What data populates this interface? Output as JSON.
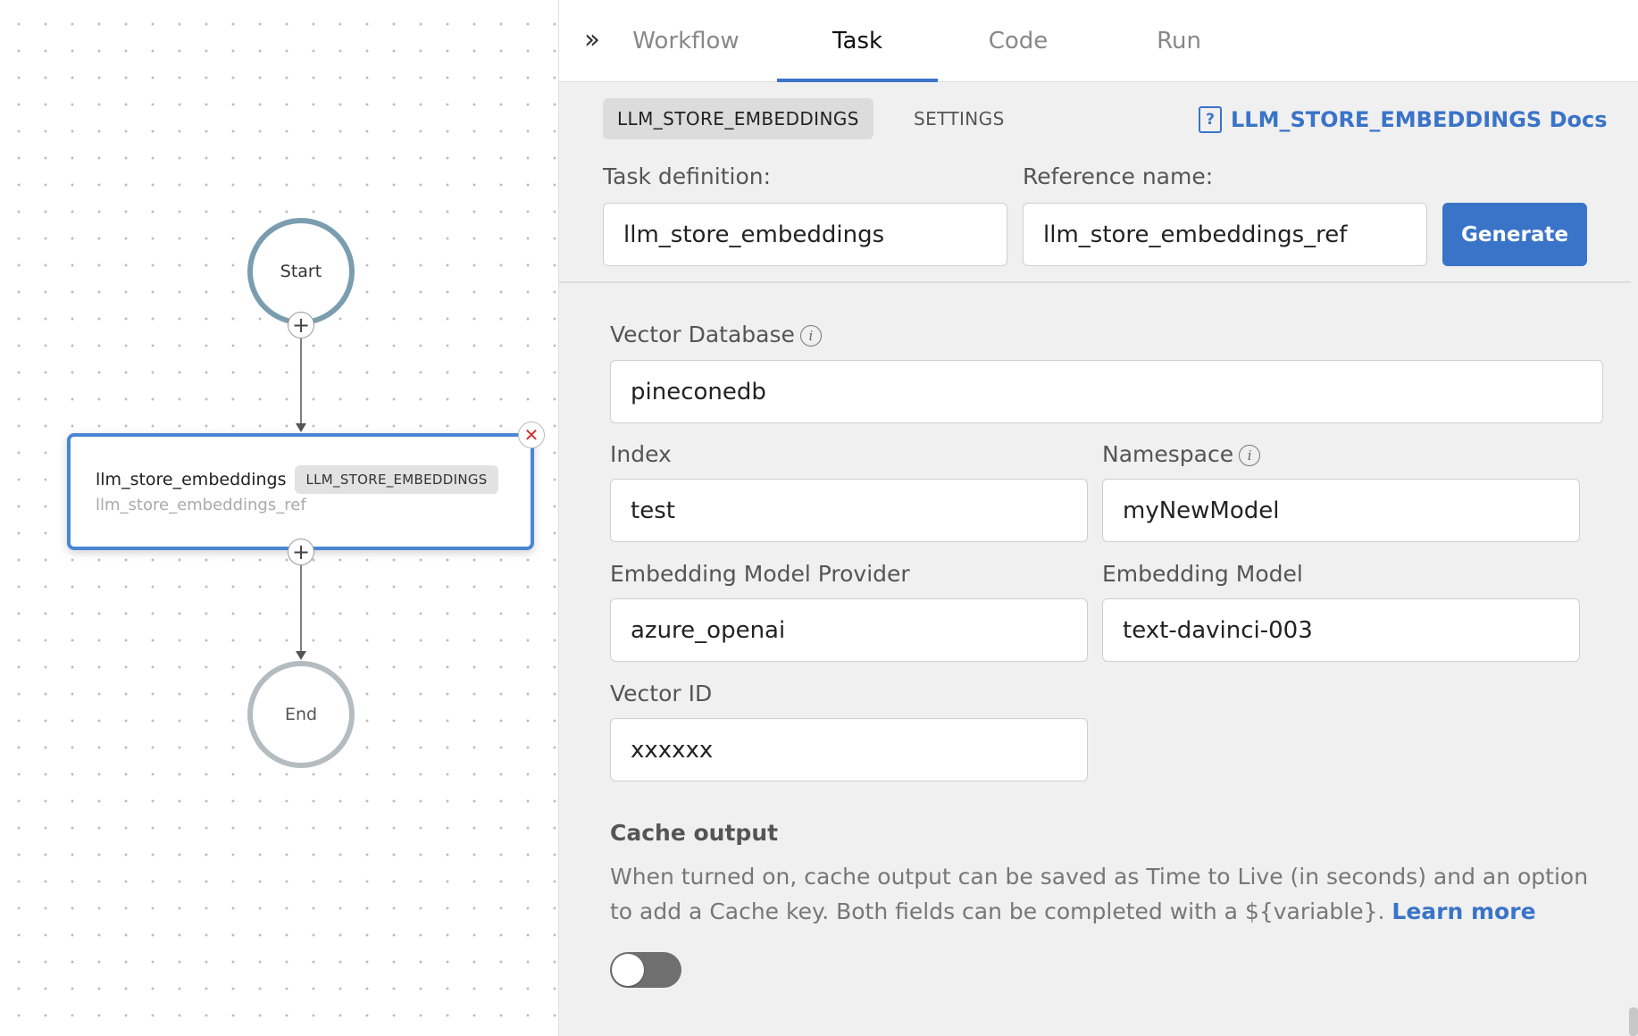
{
  "canvas": {
    "start_label": "Start",
    "end_label": "End",
    "task_node": {
      "name": "llm_store_embeddings",
      "type": "LLM_STORE_EMBEDDINGS",
      "ref": "llm_store_embeddings_ref"
    }
  },
  "tabs": [
    {
      "label": "Workflow",
      "active": false
    },
    {
      "label": "Task",
      "active": true
    },
    {
      "label": "Code",
      "active": false
    },
    {
      "label": "Run",
      "active": false
    }
  ],
  "subnav": {
    "active_chip": "LLM_STORE_EMBEDDINGS",
    "settings_chip": "SETTINGS",
    "docs_link": "LLM_STORE_EMBEDDINGS Docs"
  },
  "task_definition": {
    "label": "Task definition:",
    "value": "llm_store_embeddings"
  },
  "reference_name": {
    "label": "Reference name:",
    "value": "llm_store_embeddings_ref"
  },
  "generate_label": "Generate",
  "form": {
    "vector_database": {
      "label": "Vector Database",
      "value": "pineconedb"
    },
    "index": {
      "label": "Index",
      "value": "test"
    },
    "namespace": {
      "label": "Namespace",
      "value": "myNewModel"
    },
    "embedding_model_provider": {
      "label": "Embedding Model Provider",
      "value": "azure_openai"
    },
    "embedding_model": {
      "label": "Embedding Model",
      "value": "text-davinci-003"
    },
    "vector_id": {
      "label": "Vector ID",
      "value": "xxxxxx"
    }
  },
  "cache": {
    "title": "Cache output",
    "description": "When turned on, cache output can be saved as Time to Live (in seconds) and an option to add a Cache key. Both fields can be completed with a ${variable}.",
    "learn_more": "Learn more",
    "enabled": false
  },
  "colors": {
    "accent": "#3a74c8",
    "start_ring": "#7b9db0",
    "end_ring": "#b5bcc0",
    "delete": "#d32f2f"
  }
}
